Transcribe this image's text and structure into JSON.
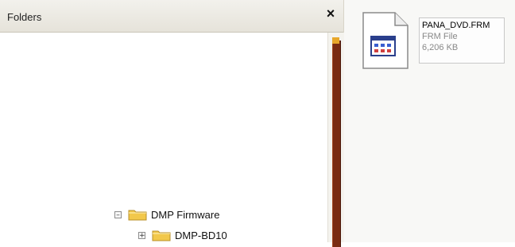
{
  "folders_panel": {
    "title": "Folders",
    "close_label": "×",
    "tree": [
      {
        "label": "DMP Firmware",
        "expander": "–"
      },
      {
        "label": "DMP-BD10",
        "expander": "+"
      }
    ]
  },
  "file_pane": {
    "file": {
      "name": "PANA_DVD.FRM",
      "type": "FRM File",
      "size": "6,206 KB",
      "icon": "generic-file-icon"
    }
  },
  "colors": {
    "folder": "#f2c84b",
    "scrollbar_track": "#7a2b12",
    "scrollbar_thumb": "#e8a72a"
  }
}
